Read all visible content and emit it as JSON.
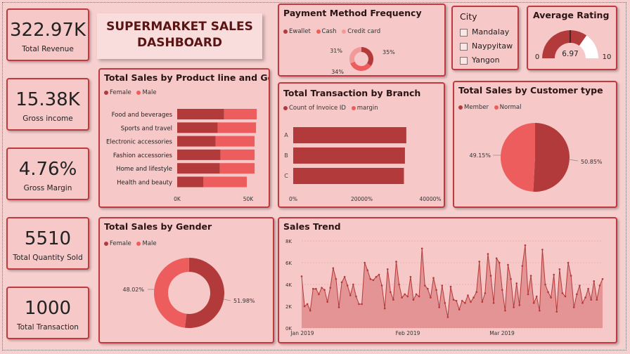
{
  "dashboard": {
    "title_line1": "SUPERMARKET SALES",
    "title_line2": "DASHBOARD"
  },
  "kpis": [
    {
      "value": "322.97K",
      "label": "Total Revenue"
    },
    {
      "value": "15.38K",
      "label": "Gross income"
    },
    {
      "value": "4.76%",
      "label": "Gross Margin"
    },
    {
      "value": "5510",
      "label": "Total Quantity Sold"
    },
    {
      "value": "1000",
      "label": "Total Transaction"
    }
  ],
  "colors": {
    "dark": "#b33a3a",
    "light": "#ee5d5d",
    "pale": "#f29a9a",
    "card_bg": "#f6c8c8",
    "border": "#c0393f"
  },
  "payment": {
    "title": "Payment Method Frequency",
    "legend": [
      "Ewallet",
      "Cash",
      "Credit card"
    ],
    "chart_data": {
      "type": "pie",
      "categories": [
        "Ewallet",
        "Cash",
        "Credit card"
      ],
      "values": [
        35,
        34,
        31
      ],
      "labels": [
        "35%",
        "34%",
        "31%"
      ]
    }
  },
  "city": {
    "title": "City",
    "options": [
      "Mandalay",
      "Naypyitaw",
      "Yangon"
    ]
  },
  "rating": {
    "title": "Average Rating",
    "value": "6.97",
    "min": "0",
    "max": "10",
    "chart_data": {
      "type": "gauge",
      "value": 6.97,
      "min": 0,
      "max": 10
    }
  },
  "productline": {
    "title": "Total Sales by Product line and Gender",
    "legend": [
      "Female",
      "Male"
    ],
    "chart_data": {
      "type": "bar",
      "categories": [
        "Food and beverages",
        "Sports and travel",
        "Electronic accessories",
        "Fashion accessories",
        "Home and lifestyle",
        "Health and beauty"
      ],
      "series": [
        {
          "name": "Female",
          "values": [
            33000,
            28500,
            27000,
            30500,
            30000,
            18500
          ]
        },
        {
          "name": "Male",
          "values": [
            23000,
            27000,
            27500,
            24000,
            24500,
            30500
          ]
        }
      ],
      "xlim": [
        0,
        56000
      ],
      "ticks": [
        "0K",
        "50K"
      ]
    }
  },
  "branch": {
    "title": "Total Transaction by Branch",
    "legend": [
      "Count of Invoice ID",
      "margin"
    ],
    "chart_data": {
      "type": "bar",
      "categories": [
        "A",
        "B",
        "C"
      ],
      "values": [
        33000,
        32600,
        32300
      ],
      "xlim": [
        0,
        40000
      ],
      "ticks": [
        "0%",
        "20000%",
        "40000%"
      ]
    }
  },
  "customer": {
    "title": "Total Sales by Customer type",
    "legend": [
      "Member",
      "Normal"
    ],
    "chart_data": {
      "type": "pie",
      "categories": [
        "Member",
        "Normal"
      ],
      "values": [
        50.85,
        49.15
      ],
      "labels": [
        "50.85%",
        "49.15%"
      ]
    }
  },
  "gender": {
    "title": "Total Sales by Gender",
    "legend": [
      "Female",
      "Male"
    ],
    "chart_data": {
      "type": "pie",
      "categories": [
        "Female",
        "Male"
      ],
      "values": [
        51.98,
        48.02
      ],
      "labels": [
        "51.98%",
        "48.02%"
      ]
    }
  },
  "trend": {
    "title": "Sales Trend",
    "chart_data": {
      "type": "area",
      "x_start": "2019-01-01",
      "x_labels": [
        "Jan 2019",
        "Feb 2019",
        "Mar 2019"
      ],
      "ylim": [
        0,
        8000
      ],
      "y_ticks": [
        "0K",
        "2K",
        "4K",
        "6K",
        "8K"
      ],
      "values": [
        4750,
        2000,
        2200,
        1600,
        3600,
        3600,
        3100,
        3700,
        3500,
        2400,
        3700,
        5500,
        4500,
        1900,
        4200,
        4700,
        3900,
        3000,
        4000,
        2900,
        2200,
        2200,
        6000,
        5300,
        4500,
        4400,
        4700,
        4900,
        3900,
        1800,
        5400,
        3300,
        2600,
        6100,
        4000,
        2800,
        3100,
        2900,
        4700,
        2600,
        3100,
        2900,
        7300,
        3900,
        3600,
        2800,
        4600,
        3500,
        1900,
        3900,
        2300,
        1000,
        3800,
        2600,
        2500,
        1700,
        2500,
        2300,
        3000,
        2400,
        2800,
        3300,
        6100,
        2400,
        3200,
        6800,
        4800,
        2300,
        6400,
        6000,
        3500,
        1600,
        5800,
        4500,
        1900,
        4100,
        2100,
        5700,
        7600,
        3100,
        4800,
        2300,
        2900,
        1600,
        7200,
        4000,
        3300,
        2800,
        4900,
        1500,
        5400,
        3200,
        2900,
        6000,
        4800,
        1900,
        3100,
        3900,
        2300,
        2800,
        3600,
        2600,
        4300,
        2600,
        3900,
        4500
      ]
    }
  }
}
